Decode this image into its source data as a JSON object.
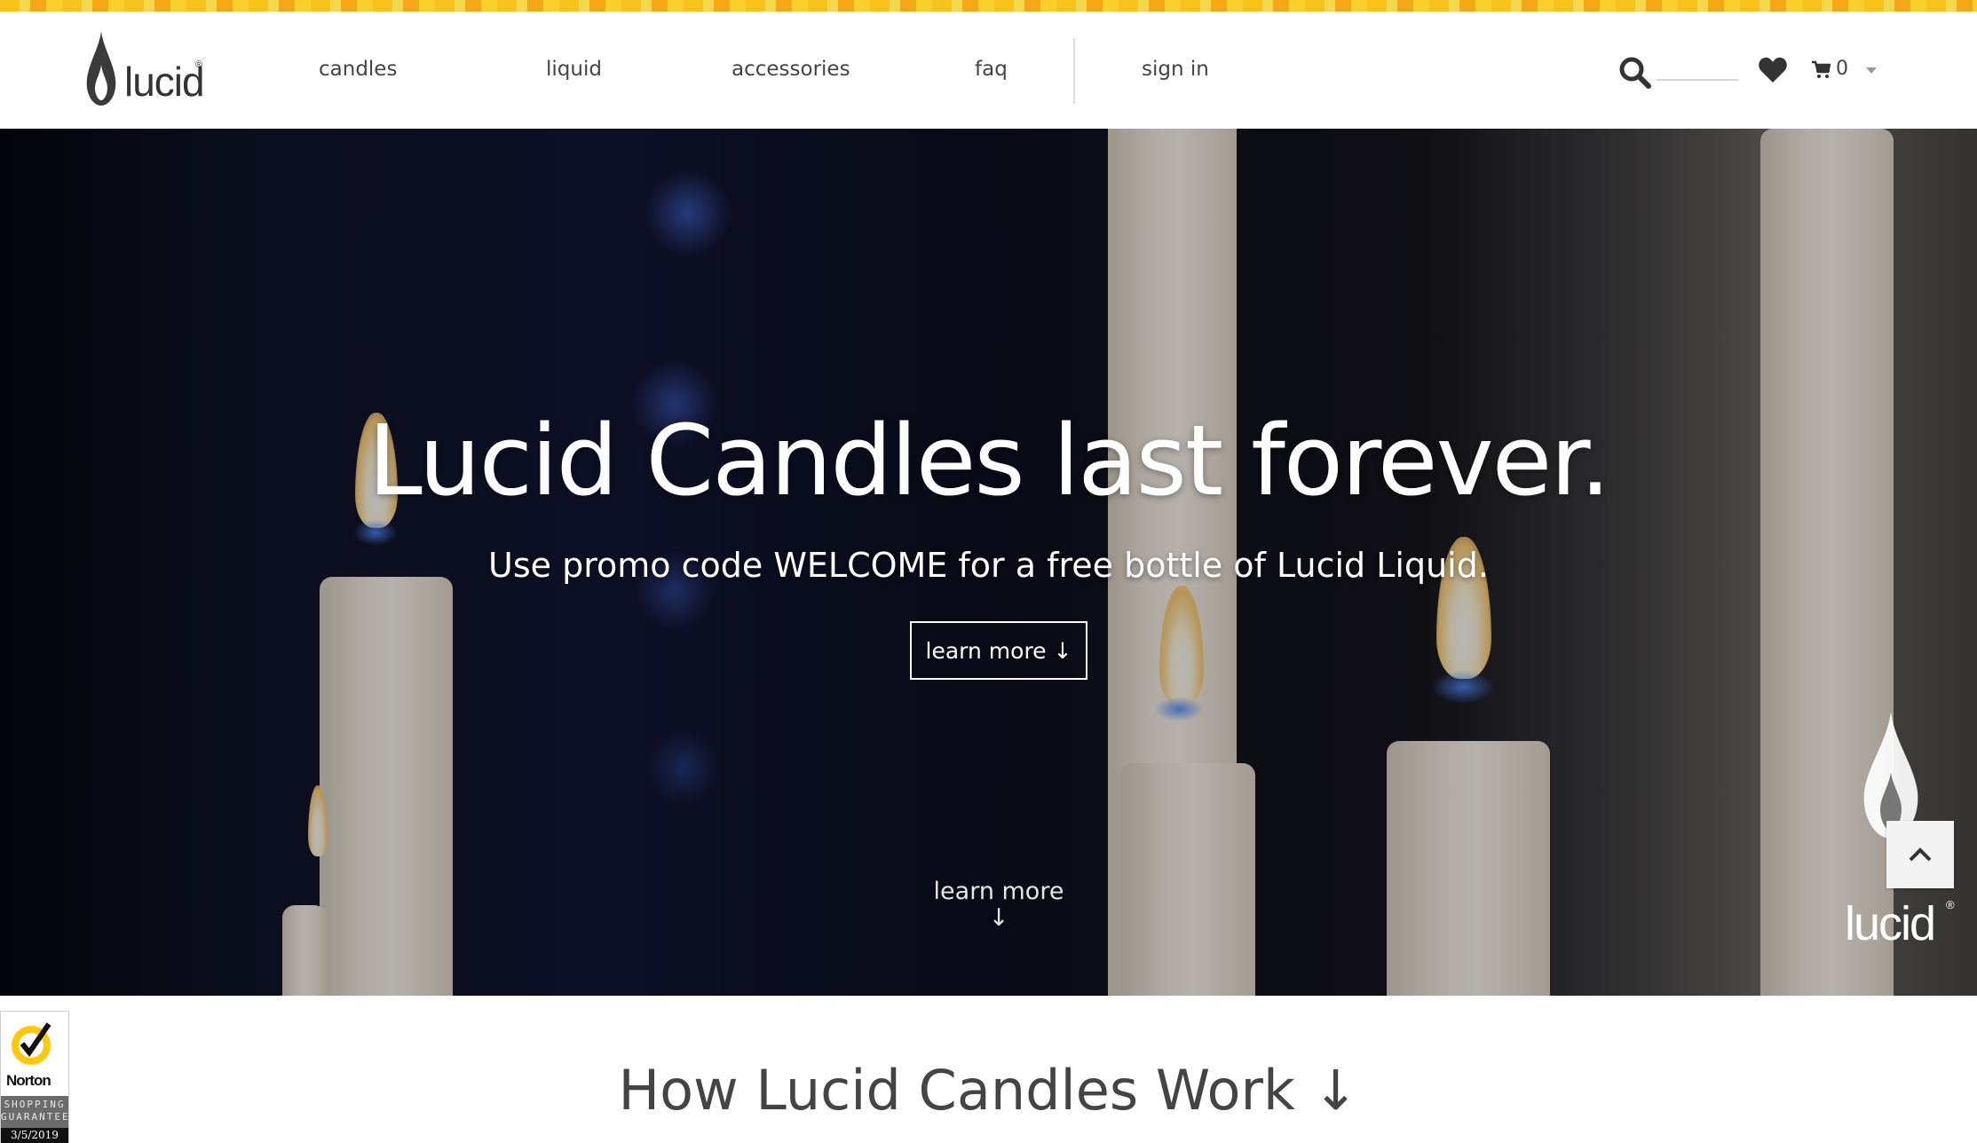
{
  "header": {
    "logo_text": "lucid",
    "logo_mark": "®",
    "nav": [
      {
        "label": "candles"
      },
      {
        "label": "liquid"
      },
      {
        "label": "accessories"
      },
      {
        "label": "faq"
      },
      {
        "label": "sign in"
      }
    ],
    "icons": {
      "search": "search-icon",
      "wishlist": "heart-icon",
      "cart": "cart-icon"
    },
    "cart_count": "0"
  },
  "hero": {
    "title": "Lucid Candles last forever.",
    "subtitle": "Use promo code WELCOME for a free bottle of Lucid Liquid.",
    "button_label": "learn more ↓",
    "learn_more_label": "learn more",
    "learn_more_arrow": "↓",
    "watermark_text": "lucid",
    "watermark_mark": "®"
  },
  "norton": {
    "brand": "Norton",
    "guarantee_line1": "SHOPPING",
    "guarantee_line2": "GUARANTEE",
    "date": "3/5/2019"
  },
  "section": {
    "title": "How Lucid Candles Work ↓"
  },
  "colors": {
    "accent_strip": "#f7c21a",
    "text_dark": "#444444",
    "hero_text": "#ffffff"
  }
}
